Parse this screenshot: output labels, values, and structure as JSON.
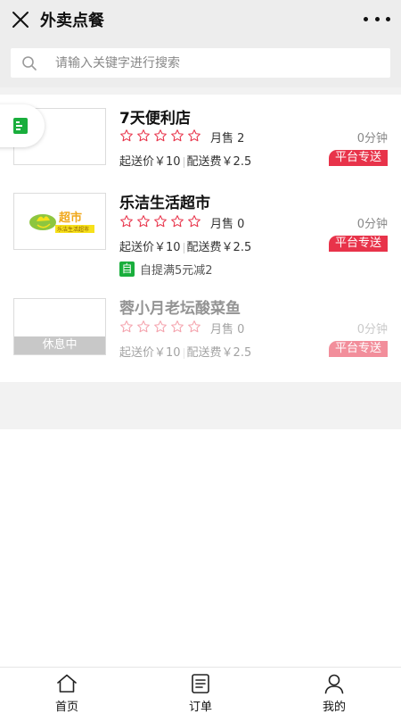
{
  "header": {
    "title": "外卖点餐",
    "close_icon": "close-icon",
    "more_icon": "more-dots-icon"
  },
  "search": {
    "placeholder": "请输入关键字进行搜索",
    "value": ""
  },
  "stores": [
    {
      "name": "7天便利店",
      "rating": 0,
      "sales": "月售 2",
      "time": "0分钟",
      "min_order": "起送价￥10",
      "delivery_fee": "配送费￥2.5",
      "delivery_tag": "平台专送"
    },
    {
      "name": "乐洁生活超市",
      "rating": 0,
      "sales": "月售 0",
      "time": "0分钟",
      "min_order": "起送价￥10",
      "delivery_fee": "配送费￥2.5",
      "delivery_tag": "平台专送",
      "logo_text": "超市",
      "logo_subtext": "乐洁生活超市",
      "promo_tag": "自",
      "promo_text": "自提满5元减2"
    },
    {
      "name": "蓉小月老坛酸菜鱼",
      "rating": 0,
      "sales": "月售 0",
      "time": "0分钟",
      "min_order": "起送价￥10",
      "delivery_fee": "配送费￥2.5",
      "delivery_tag": "平台专送",
      "status_label": "休息中"
    }
  ],
  "tabbar": [
    {
      "label": "首页",
      "icon": "home-icon"
    },
    {
      "label": "订单",
      "icon": "order-icon"
    },
    {
      "label": "我的",
      "icon": "profile-icon"
    }
  ],
  "colors": {
    "accent_red": "#e8334a",
    "star_red": "#e8334a",
    "promo_green": "#19ae3c",
    "float_green": "#19ae3c"
  }
}
